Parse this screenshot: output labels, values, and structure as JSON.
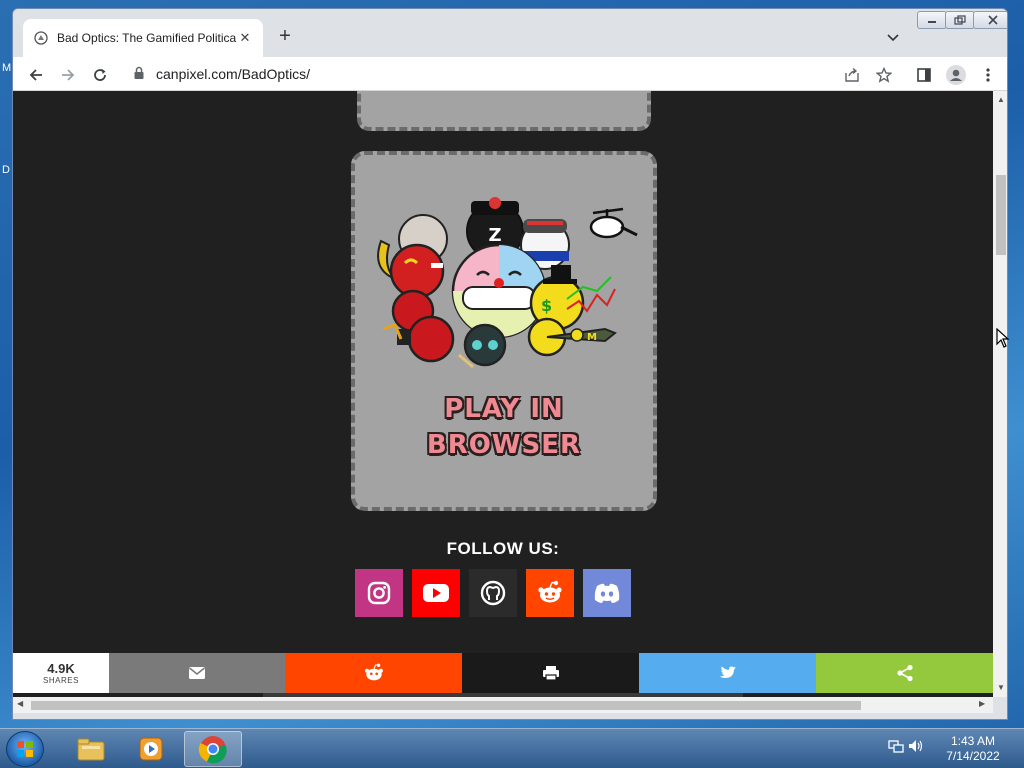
{
  "browser": {
    "tab_title": "Bad Optics: The Gamified Politica",
    "new_tab": "+",
    "tab_close": "✕",
    "url": "canpixel.com/BadOptics/"
  },
  "page": {
    "play_line1": "PLAY IN",
    "play_line2": "BROWSER",
    "follow_label": "FOLLOW US:",
    "socials": [
      "instagram",
      "youtube",
      "github",
      "reddit",
      "discord"
    ],
    "share_count": "4.9K",
    "share_label": "SHARES",
    "share_buttons": [
      "email",
      "reddit",
      "print",
      "twitter",
      "share"
    ]
  },
  "colors": {
    "page_bg": "#202020",
    "card_bg": "#a3a3a3",
    "instagram": "#c13584",
    "youtube": "#ff0000",
    "github": "#2b2b2b",
    "reddit": "#ff4500",
    "discord": "#7289da",
    "share_email": "#7a7a7a",
    "share_print": "#1a1a1a",
    "share_twitter": "#55acee",
    "share_generic": "#95c93d"
  },
  "desktop": {
    "edge_letter_1": "M",
    "edge_letter_2": "D"
  },
  "taskbar": {
    "time": "1:43 AM",
    "date": "7/14/2022"
  }
}
